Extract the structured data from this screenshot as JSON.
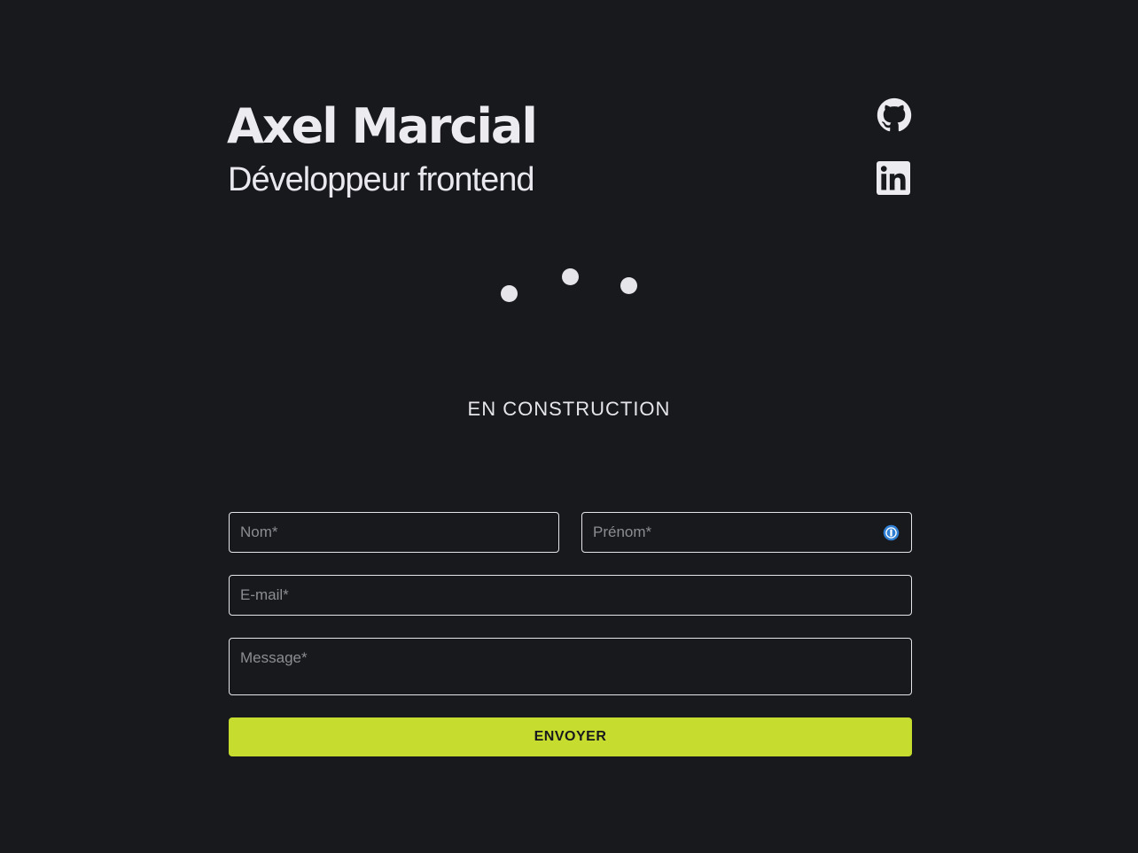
{
  "header": {
    "name": "Axel Marcial",
    "role": "Développeur frontend"
  },
  "social": {
    "github_icon": "github-icon",
    "linkedin_icon": "linkedin-icon"
  },
  "loader": {
    "icon": "loading-dots"
  },
  "status_text": "EN CONSTRUCTION",
  "contact_form": {
    "nom_placeholder": "Nom*",
    "prenom_placeholder": "Prénom*",
    "email_placeholder": "E-mail*",
    "message_placeholder": "Message*",
    "submit_label": "ENVOYER",
    "password_manager_icon": "password-manager-icon"
  },
  "colors": {
    "background": "#18191d",
    "text": "#e6e6ea",
    "accent": "#c6dd2f",
    "password_manager": "#2f7fd4"
  }
}
